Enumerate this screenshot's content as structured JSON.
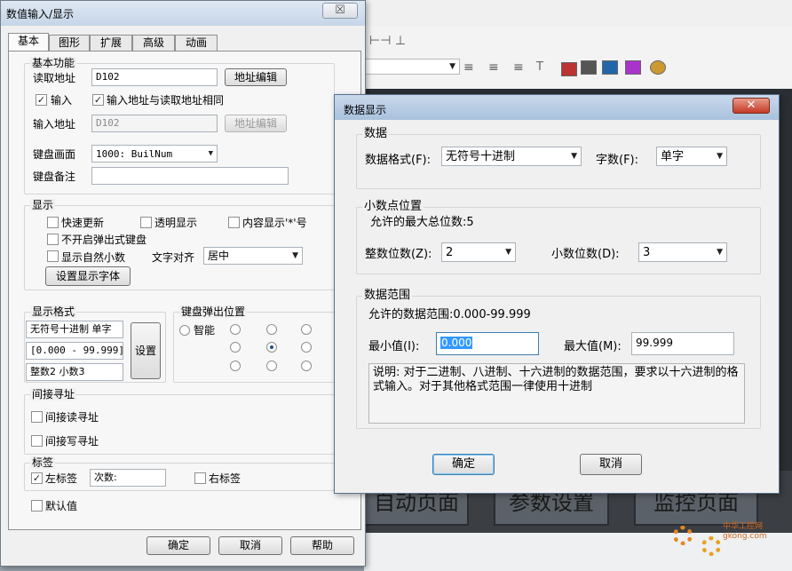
{
  "main_window": {
    "title": "数值输入/显示",
    "close": "☒",
    "tabs": [
      "基本",
      "图形",
      "扩展",
      "高级",
      "动画"
    ],
    "basic": {
      "title": "基本功能",
      "read_addr_label": "读取地址",
      "read_addr_value": "D102",
      "addr_edit": "地址编辑",
      "input_check_label": "输入",
      "same_addr_label": "输入地址与读取地址相同",
      "input_addr_label": "输入地址",
      "input_addr_value": "D102",
      "addr_edit_disabled": "地址编辑",
      "keyboard_label": "键盘画面",
      "keyboard_value": "1000: BuilNum",
      "keyboard_note_label": "键盘备注"
    },
    "display": {
      "title": "显示",
      "quick_update": "快速更新",
      "transparent": "透明显示",
      "content_mask": "内容显示'*'号",
      "no_popup_kb": "不开启弹出式键盘",
      "natural_decimal": "显示自然小数",
      "text_align_label": "文字对齐",
      "text_align_value": "居中",
      "font_button": "设置显示字体"
    },
    "format": {
      "title": "显示格式",
      "line1": "无符号十进制 单字",
      "line2": "[0.000 - 99.999]",
      "line3": "整数2 小数3",
      "set_button": "设置"
    },
    "popup": {
      "title": "键盘弹出位置",
      "smart": "智能"
    },
    "indirect": {
      "title": "间接寻址",
      "read": "间接读寻址",
      "write": "间接写寻址"
    },
    "label": {
      "title": "标签",
      "left": "左标签",
      "count_label": "次数:",
      "right": "右标签"
    },
    "default": "默认值",
    "ok": "确定",
    "cancel": "取消",
    "help": "帮助"
  },
  "data_dialog": {
    "title": "数据显示",
    "close": "✕",
    "data_group": "数据",
    "format_label": "数据格式(F):",
    "format_value": "无符号十进制",
    "words_label": "字数(F):",
    "words_value": "单字",
    "decimal_group": "小数点位置",
    "max_digits": "允许的最大总位数:5",
    "int_label": "整数位数(Z):",
    "int_value": "2",
    "frac_label": "小数位数(D):",
    "frac_value": "3",
    "range_group": "数据范围",
    "range_text": "允许的数据范围:0.000-99.999",
    "min_label": "最小值(I):",
    "min_value": "0.000",
    "max_label": "最大值(M):",
    "max_value": "99.999",
    "note": "说明: 对于二进制、八进制、十六进制的数据范围，要求以十六进制的格式输入。对于其他格式范围一律使用十进制",
    "ok": "确定",
    "cancel": "取消"
  },
  "background": {
    "buttons": [
      "自动页面",
      "参数设置",
      "监控页面"
    ],
    "watermark": "中华工控网 gkong.com"
  }
}
